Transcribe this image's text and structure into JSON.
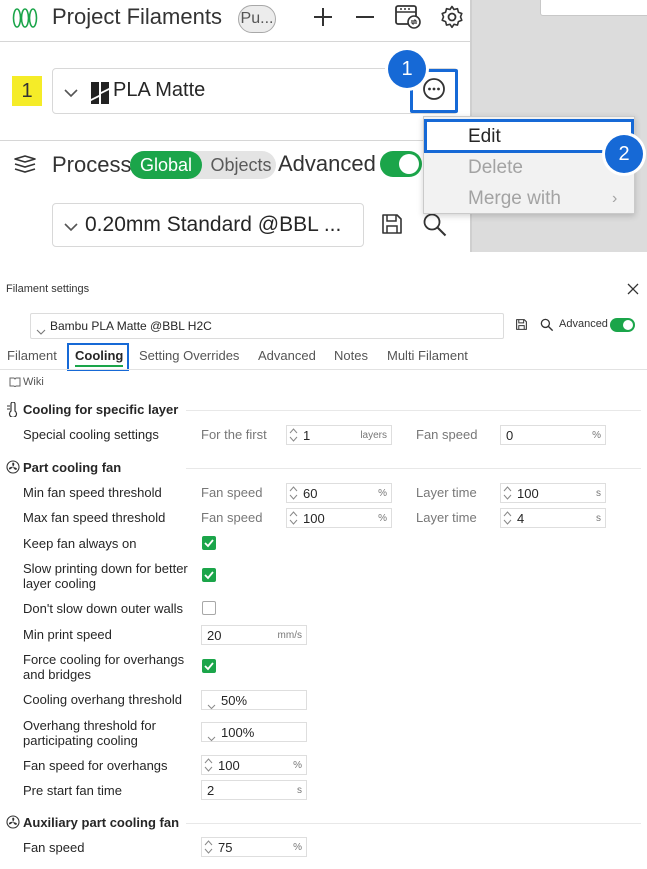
{
  "top_panel": {
    "project_filaments": {
      "title": "Project Filaments",
      "pill_label": "Pu..."
    },
    "filament_row": {
      "index": "1",
      "name": "PLA Matte"
    },
    "process": {
      "title": "Process",
      "segment_global": "Global",
      "segment_objects": "Objects",
      "advanced_label": "Advanced",
      "preset": "0.20mm Standard @BBL ..."
    },
    "context_menu": {
      "edit": "Edit",
      "delete": "Delete",
      "merge": "Merge with",
      "merge_chevron": "›"
    },
    "steps": [
      "1",
      "2"
    ]
  },
  "dialog": {
    "title": "Filament settings",
    "preset": "Bambu PLA Matte @BBL H2C",
    "advanced_label": "Advanced",
    "tabs": [
      "Filament",
      "Cooling",
      "Setting Overrides",
      "Advanced",
      "Notes",
      "Multi Filament"
    ],
    "wiki": "Wiki",
    "sections": {
      "specific_layer": "Cooling for specific layer",
      "part_fan": "Part cooling fan",
      "aux_fan": "Auxiliary part cooling fan"
    },
    "special_cooling": {
      "label": "Special cooling settings",
      "for_first_label": "For the first",
      "layers_value": "1",
      "layers_unit": "layers",
      "fan_speed_label": "Fan speed",
      "fan_speed_value": "0",
      "fan_speed_unit": "%"
    },
    "min_fan": {
      "label": "Min fan speed threshold",
      "speed_label": "Fan speed",
      "speed_value": "60",
      "speed_unit": "%",
      "time_label": "Layer time",
      "time_value": "100",
      "time_unit": "s"
    },
    "max_fan": {
      "label": "Max fan speed threshold",
      "speed_label": "Fan speed",
      "speed_value": "100",
      "speed_unit": "%",
      "time_label": "Layer time",
      "time_value": "4",
      "time_unit": "s"
    },
    "keep_fan_on": {
      "label": "Keep fan always on",
      "checked": true
    },
    "slow_printing": {
      "line1": "Slow printing down for better",
      "line2": "layer cooling",
      "checked": true
    },
    "dont_slow_outer": {
      "label": "Don't slow down outer walls",
      "checked": false
    },
    "min_print_speed": {
      "label": "Min print speed",
      "value": "20",
      "unit": "mm/s"
    },
    "force_cooling": {
      "line1": "Force cooling for overhangs",
      "line2": "and bridges",
      "checked": true
    },
    "overhang_threshold": {
      "label": "Cooling overhang threshold",
      "value": "50%"
    },
    "participating": {
      "line1": "Overhang threshold for",
      "line2": "participating cooling",
      "value": "100%"
    },
    "fan_overhangs": {
      "label": "Fan speed for overhangs",
      "value": "100",
      "unit": "%"
    },
    "pre_start": {
      "label": "Pre start fan time",
      "value": "2",
      "unit": "s"
    },
    "aux_fan_speed": {
      "label": "Fan speed",
      "value": "75",
      "unit": "%"
    }
  },
  "colors": {
    "accent_green": "#1ba54a",
    "highlight_blue": "#1669d6",
    "badge_yellow": "#f5ec28"
  },
  "icons": [
    "filament-spools-icon",
    "plus-icon",
    "minus-icon",
    "printer-sync-icon",
    "gear-icon",
    "chevron-down-icon",
    "bambu-logo-icon",
    "more-dots-icon",
    "process-layers-icon",
    "save-icon",
    "search-icon",
    "close-icon",
    "book-icon",
    "thermometer-icon",
    "fan-icon",
    "spin-arrows-icon",
    "check-icon"
  ]
}
